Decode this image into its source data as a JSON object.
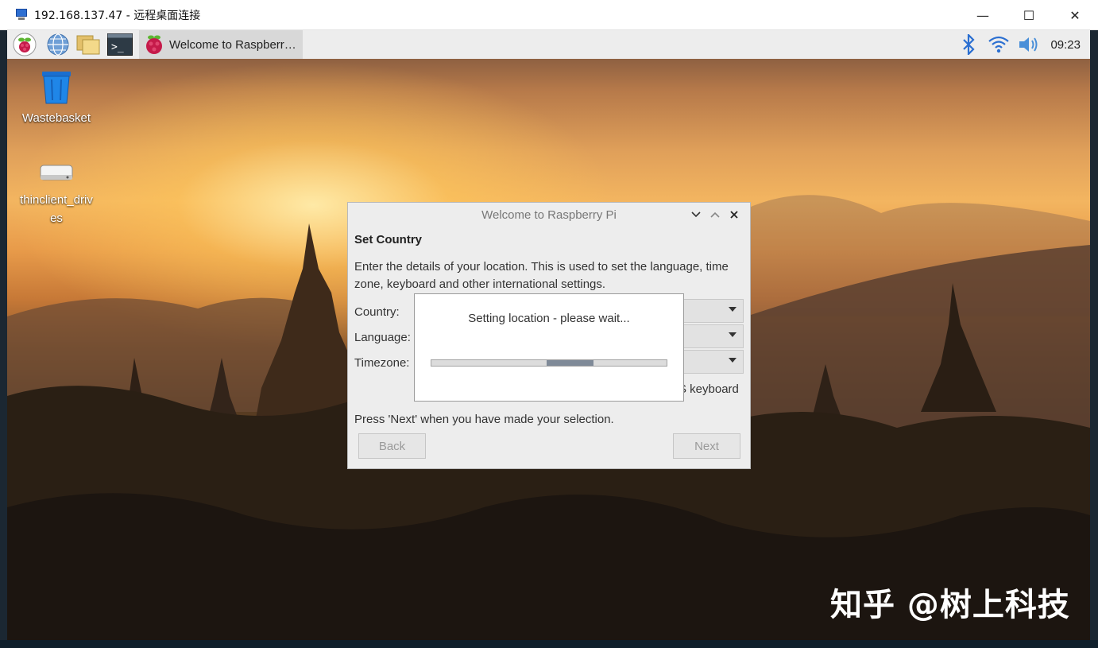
{
  "rdp_window": {
    "title": "192.168.137.47 - 远程桌面连接",
    "minimize_glyph": "—",
    "maximize_glyph": "☐",
    "close_glyph": "✕"
  },
  "taskbar": {
    "launchers": [
      "raspberry-menu-icon",
      "globe-icon",
      "folders-icon",
      "terminal-icon"
    ],
    "task_label": "Welcome to Raspberr…",
    "clock": "09:23"
  },
  "desktop_icons": [
    {
      "label": "Wastebasket",
      "icon": "wastebasket-icon"
    },
    {
      "label": "thinclient_driv\nes",
      "icon": "drive-icon"
    }
  ],
  "dialog": {
    "title": "Welcome to Raspberry Pi",
    "heading": "Set Country",
    "description": "Enter the details of your location. This is used to set the language, time zone, keyboard and other international settings.",
    "fields": {
      "country_label": "Country:",
      "language_label": "Language:",
      "timezone_label": "Timezone:"
    },
    "us_keyboard_partial": "S keyboard",
    "footer": "Press 'Next' when you have made your selection.",
    "back_label": "Back",
    "next_label": "Next",
    "controls": {
      "down": "⌄",
      "up": "⌃",
      "close": "✕"
    }
  },
  "progress_popup": {
    "message": "Setting location - please wait...",
    "indeterminate_block": {
      "start": 0.49,
      "end": 0.69
    }
  },
  "watermark": "知乎 @树上科技",
  "colors": {
    "taskbar_bg": "#ededed",
    "dialog_bg": "#ededed",
    "progress_fill": "#7f8a98",
    "bluetooth": "#2b6fd1",
    "wifi": "#2b6fd1"
  }
}
